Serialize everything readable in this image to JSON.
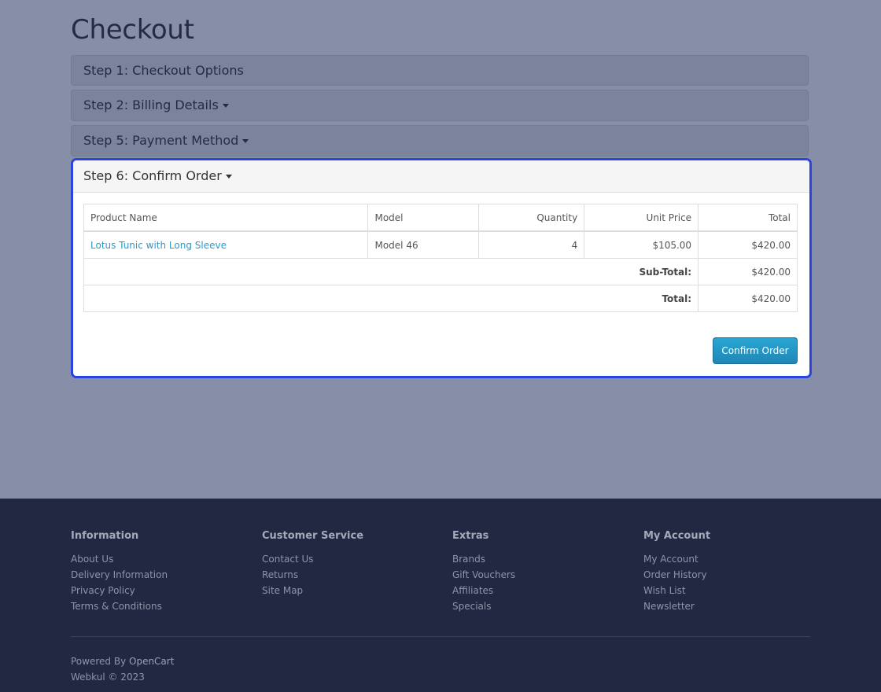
{
  "page": {
    "title": "Checkout"
  },
  "steps": {
    "step1": "Step 1: Checkout Options",
    "step2": "Step 2: Billing Details",
    "step5": "Step 5: Payment Method",
    "step6": "Step 6: Confirm Order"
  },
  "order": {
    "headers": [
      "Product Name",
      "Model",
      "Quantity",
      "Unit Price",
      "Total"
    ],
    "rows": [
      {
        "product": "Lotus Tunic with Long Sleeve",
        "model": "Model 46",
        "quantity": "4",
        "unit_price": "$105.00",
        "total": "$420.00"
      }
    ],
    "totals": [
      {
        "label": "Sub-Total:",
        "value": "$420.00"
      },
      {
        "label": "Total:",
        "value": "$420.00"
      }
    ],
    "confirm_label": "Confirm Order"
  },
  "footer": {
    "columns": [
      {
        "title": "Information",
        "links": [
          "About Us",
          "Delivery Information",
          "Privacy Policy",
          "Terms & Conditions"
        ]
      },
      {
        "title": "Customer Service",
        "links": [
          "Contact Us",
          "Returns",
          "Site Map"
        ]
      },
      {
        "title": "Extras",
        "links": [
          "Brands",
          "Gift Vouchers",
          "Affiliates",
          "Specials"
        ]
      },
      {
        "title": "My Account",
        "links": [
          "My Account",
          "Order History",
          "Wish List",
          "Newsletter"
        ]
      }
    ],
    "powered_prefix": "Powered By",
    "powered_link": "OpenCart",
    "copyright": "Webkul © 2023"
  },
  "colors": {
    "accent": "#2a9bc7",
    "focus_border": "#2a44e0",
    "footer_bg": "#222841"
  }
}
